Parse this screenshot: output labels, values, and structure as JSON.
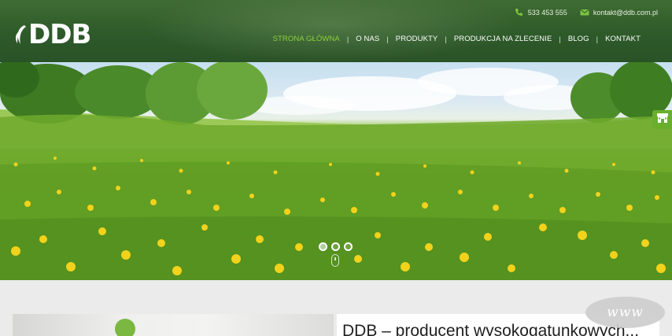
{
  "header": {
    "logo_text": "DDB",
    "phone": "533 453 555",
    "email": "kontakt@ddb.com.pl",
    "nav": [
      {
        "label": "STRONA GŁÓWNA",
        "active": true
      },
      {
        "label": "O NAS",
        "active": false
      },
      {
        "label": "PRODUKTY",
        "active": false
      },
      {
        "label": "PRODUKCJA NA ZLECENIE",
        "active": false
      },
      {
        "label": "BLOG",
        "active": false
      },
      {
        "label": "KONTAKT",
        "active": false
      }
    ]
  },
  "icons": {
    "phone": "phone-icon",
    "email": "envelope-icon",
    "side": "store-icon",
    "scroll": "mouse-scroll-icon"
  },
  "hero": {
    "slides": 3,
    "active_slide": 1
  },
  "content": {
    "headline": "DDB – producent wysokogatunkowych..."
  },
  "badge": {
    "text": "www"
  },
  "colors": {
    "header_bg": "#2e5a2a",
    "accent": "#8ccf3e",
    "side_button": "#6aae2f"
  }
}
